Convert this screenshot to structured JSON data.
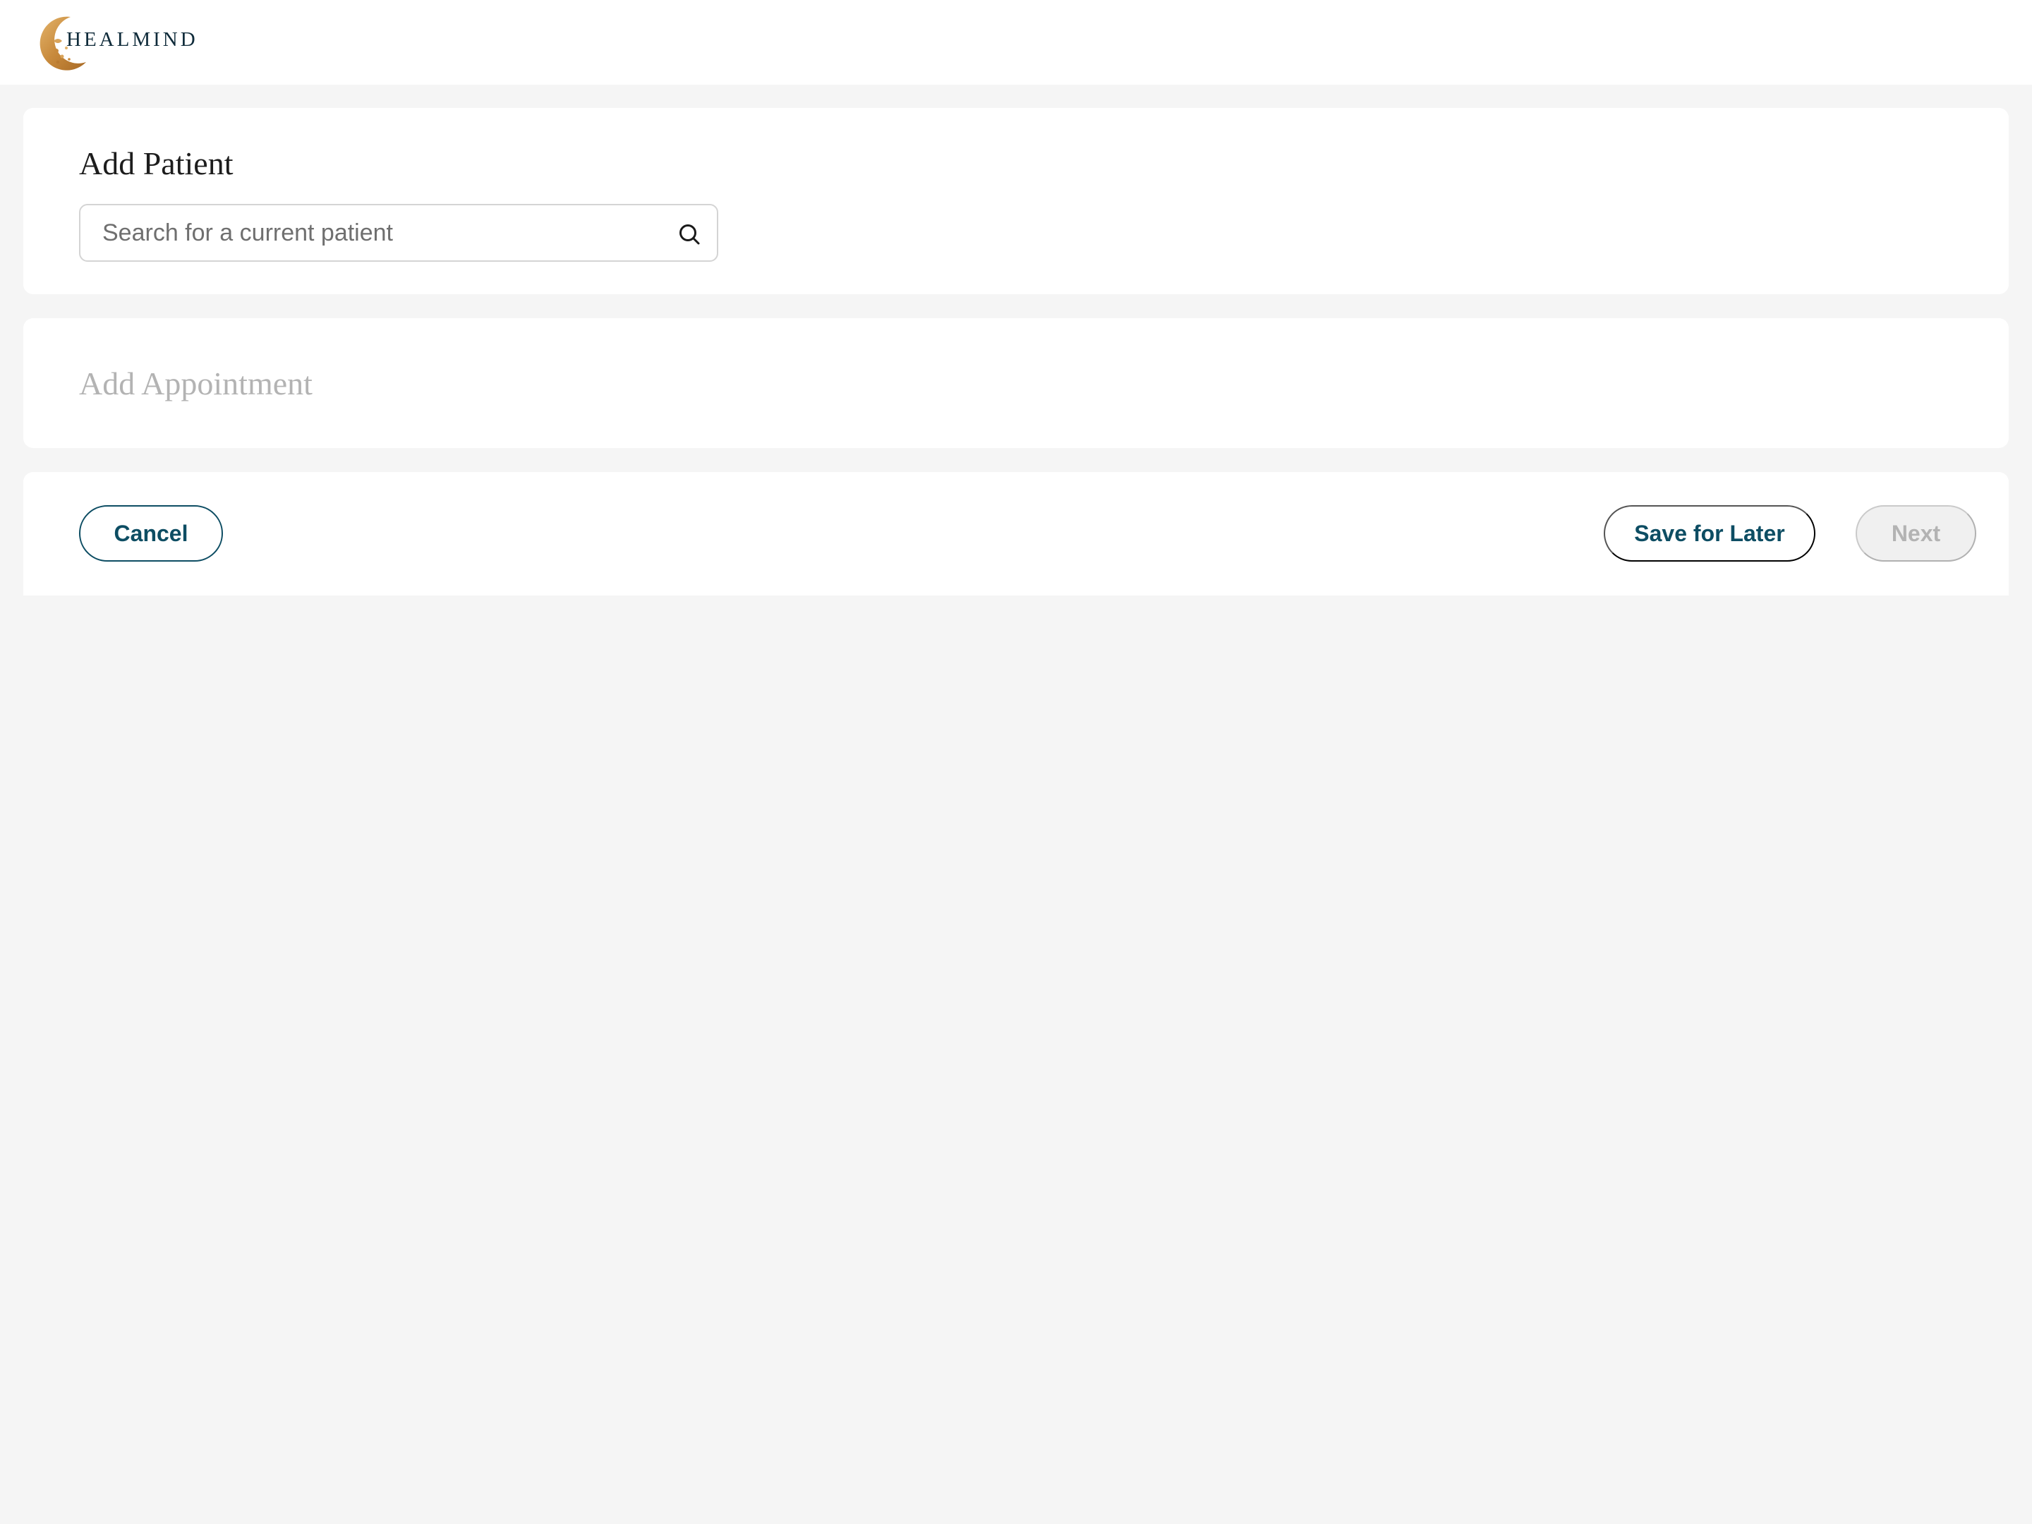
{
  "brand": {
    "name": "HEALMIND",
    "logo_icon": "crescent-moon-logo",
    "logo_color": "#c88a3c",
    "name_color": "#0f2b3a"
  },
  "patient_section": {
    "title": "Add Patient",
    "search": {
      "placeholder": "Search for a current patient",
      "value": "",
      "icon": "search-icon"
    }
  },
  "appointment_section": {
    "title": "Add Appointment",
    "state": "disabled"
  },
  "actions": {
    "cancel_label": "Cancel",
    "save_label": "Save for Later",
    "next_label": "Next",
    "next_state": "disabled"
  },
  "colors": {
    "accent": "#0d4d63",
    "page_background": "#f5f5f5",
    "card_background": "#ffffff",
    "disabled_text": "#b3b3b3"
  }
}
